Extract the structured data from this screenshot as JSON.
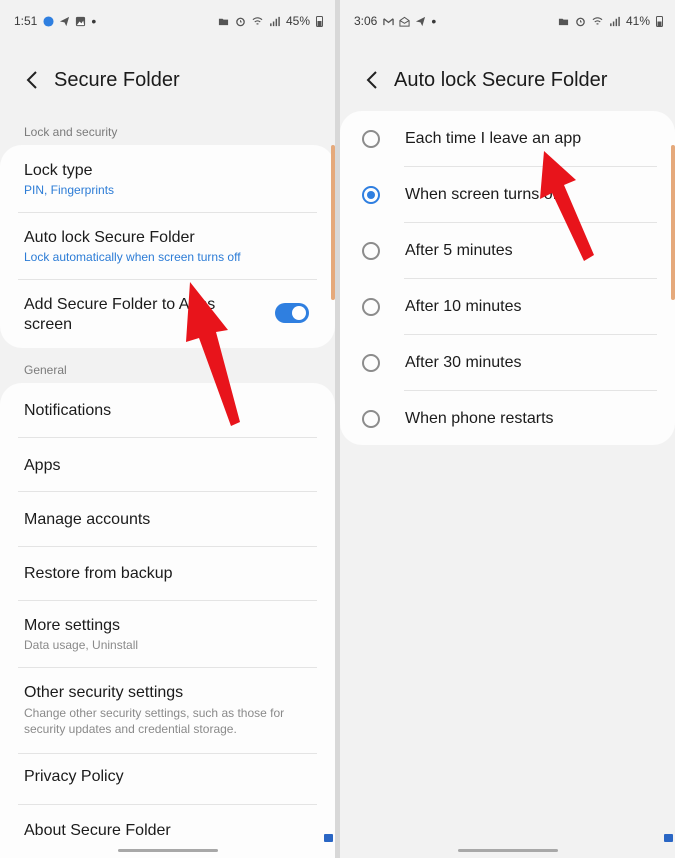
{
  "left": {
    "status": {
      "time": "1:51",
      "battery": "45%"
    },
    "title": "Secure Folder",
    "section1": "Lock and security",
    "lock_type": {
      "title": "Lock type",
      "subtitle": "PIN, Fingerprints"
    },
    "auto_lock": {
      "title": "Auto lock Secure Folder",
      "subtitle": "Lock automatically when screen turns off"
    },
    "add_to_apps": {
      "line1": "Add Secure Folder to Apps",
      "line2": "screen",
      "toggle_on": true
    },
    "section2": "General",
    "items": [
      {
        "title": "Notifications"
      },
      {
        "title": "Apps"
      },
      {
        "title": "Manage accounts"
      },
      {
        "title": "Restore from backup"
      },
      {
        "title": "More settings",
        "subtitle": "Data usage, Uninstall"
      },
      {
        "title": "Other security settings",
        "subtitle1": "Change other security settings, such as those for",
        "subtitle2": "security updates and credential storage."
      },
      {
        "title": "Privacy Policy"
      },
      {
        "title": "About Secure Folder"
      }
    ]
  },
  "right": {
    "status": {
      "time": "3:06",
      "battery": "41%"
    },
    "title": "Auto lock Secure Folder",
    "options": [
      {
        "label": "Each time I leave an app",
        "selected": false
      },
      {
        "label": "When screen turns off",
        "selected": true
      },
      {
        "label": "After 5 minutes",
        "selected": false
      },
      {
        "label": "After 10 minutes",
        "selected": false
      },
      {
        "label": "After 30 minutes",
        "selected": false
      },
      {
        "label": "When phone restarts",
        "selected": false
      }
    ]
  },
  "colors": {
    "accent": "#2f7fe0",
    "annotation_arrow": "#e8141b",
    "background": "#f2f2f2",
    "card": "#fdfdfd"
  }
}
